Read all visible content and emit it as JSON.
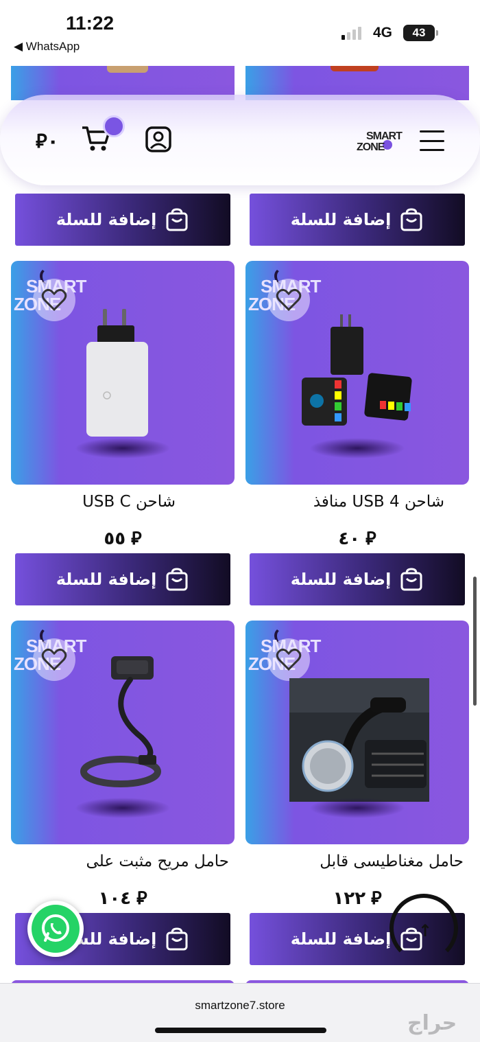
{
  "status_bar": {
    "time": "11:22",
    "back_app": "◀ WhatsApp",
    "network": "4G",
    "battery": "43"
  },
  "header": {
    "brand_line1": "SMART",
    "brand_line2": "ZONE",
    "wallet_amount": "٠",
    "currency_symbol": "⃁",
    "icons": [
      "menu-icon",
      "user-icon",
      "cart-icon"
    ]
  },
  "card_logo": {
    "line1": "SMART",
    "line2": "ZONE"
  },
  "add_to_cart_label": "إضافة للسلة",
  "products": [
    {
      "title": "",
      "price": ""
    },
    {
      "title": "",
      "price": ""
    },
    {
      "title": "شاحن USB 4 منافذ",
      "price": "٤٠"
    },
    {
      "title": "شاحن USB C",
      "price": "٥٥"
    },
    {
      "title": "حامل مغناطيسى قابل",
      "price": "١٢٢"
    },
    {
      "title": "حامل مريح مثبت على",
      "price": "١٠٤"
    }
  ],
  "currency_glyph": "⃁",
  "bottom_bar": {
    "url": "smartzone7.store",
    "watermark": "حراج"
  },
  "colors": {
    "accent": "#7a55e3",
    "card_bg": "#8a57df",
    "button_dark": "#120c24"
  }
}
